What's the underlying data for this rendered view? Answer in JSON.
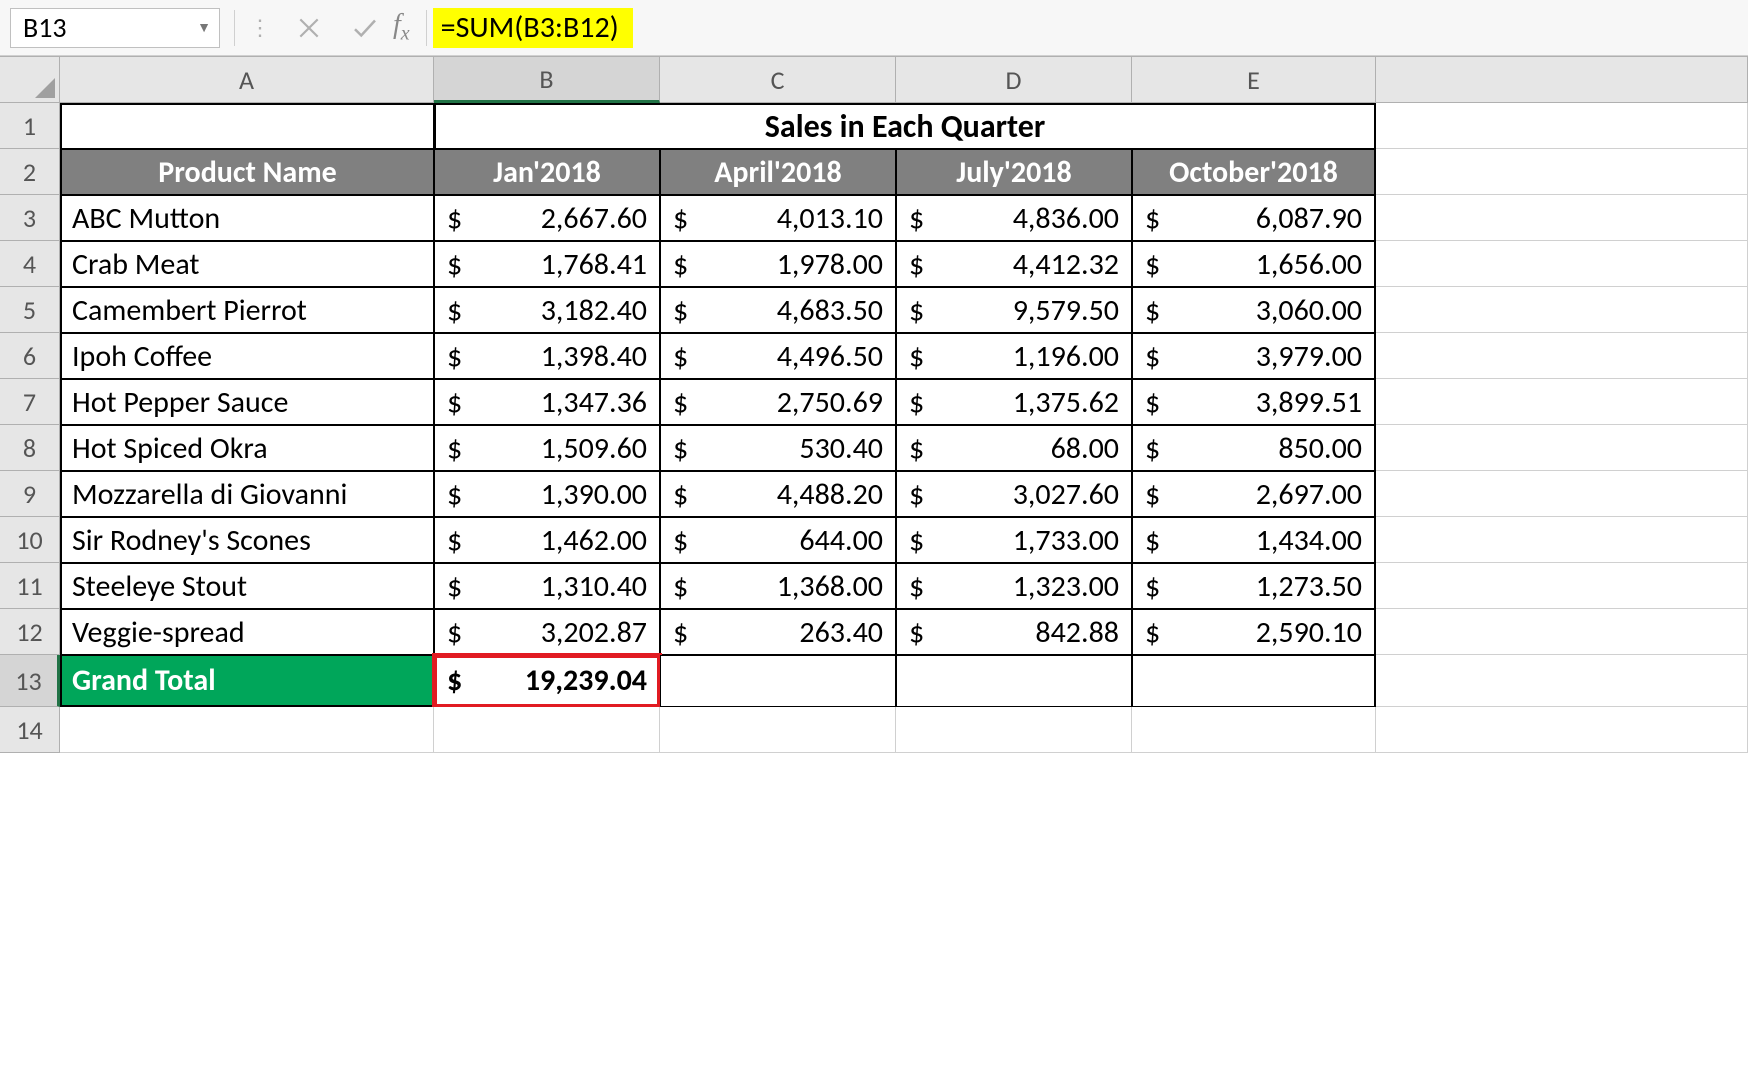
{
  "nameBox": "B13",
  "formula": "=SUM(B3:B12)",
  "columns": [
    "A",
    "B",
    "C",
    "D",
    "E"
  ],
  "mergeTitle": "Sales in Each Quarter",
  "headers": {
    "product": "Product Name",
    "q1": "Jan'2018",
    "q2": "April'2018",
    "q3": "July'2018",
    "q4": "October'2018"
  },
  "rows": [
    {
      "r": "3",
      "name": "ABC Mutton",
      "q1": "2,667.60",
      "q2": "4,013.10",
      "q3": "4,836.00",
      "q4": "6,087.90"
    },
    {
      "r": "4",
      "name": "Crab Meat",
      "q1": "1,768.41",
      "q2": "1,978.00",
      "q3": "4,412.32",
      "q4": "1,656.00"
    },
    {
      "r": "5",
      "name": "Camembert Pierrot",
      "q1": "3,182.40",
      "q2": "4,683.50",
      "q3": "9,579.50",
      "q4": "3,060.00"
    },
    {
      "r": "6",
      "name": "Ipoh Coffee",
      "q1": "1,398.40",
      "q2": "4,496.50",
      "q3": "1,196.00",
      "q4": "3,979.00"
    },
    {
      "r": "7",
      "name": "Hot Pepper Sauce",
      "q1": "1,347.36",
      "q2": "2,750.69",
      "q3": "1,375.62",
      "q4": "3,899.51"
    },
    {
      "r": "8",
      "name": " Hot Spiced Okra",
      "q1": "1,509.60",
      "q2": "530.40",
      "q3": "68.00",
      "q4": "850.00"
    },
    {
      "r": "9",
      "name": "Mozzarella di Giovanni",
      "q1": "1,390.00",
      "q2": "4,488.20",
      "q3": "3,027.60",
      "q4": "2,697.00"
    },
    {
      "r": "10",
      "name": "Sir Rodney's Scones",
      "q1": "1,462.00",
      "q2": "644.00",
      "q3": "1,733.00",
      "q4": "1,434.00"
    },
    {
      "r": "11",
      "name": "Steeleye Stout",
      "q1": "1,310.40",
      "q2": "1,368.00",
      "q3": "1,323.00",
      "q4": "1,273.50"
    },
    {
      "r": "12",
      "name": "Veggie-spread",
      "q1": "3,202.87",
      "q2": "263.40",
      "q3": "842.88",
      "q4": "2,590.10"
    }
  ],
  "grandTotal": {
    "label": "Grand Total",
    "r": "13",
    "value": "19,239.04"
  },
  "chart_data": {
    "type": "table",
    "title": "Sales in Each Quarter",
    "categories": [
      "Jan'2018",
      "April'2018",
      "July'2018",
      "October'2018"
    ],
    "series": [
      {
        "name": "ABC Mutton",
        "values": [
          2667.6,
          4013.1,
          4836.0,
          6087.9
        ]
      },
      {
        "name": "Crab Meat",
        "values": [
          1768.41,
          1978.0,
          4412.32,
          1656.0
        ]
      },
      {
        "name": "Camembert Pierrot",
        "values": [
          3182.4,
          4683.5,
          9579.5,
          3060.0
        ]
      },
      {
        "name": "Ipoh Coffee",
        "values": [
          1398.4,
          4496.5,
          1196.0,
          3979.0
        ]
      },
      {
        "name": "Hot Pepper Sauce",
        "values": [
          1347.36,
          2750.69,
          1375.62,
          3899.51
        ]
      },
      {
        "name": "Hot Spiced Okra",
        "values": [
          1509.6,
          530.4,
          68.0,
          850.0
        ]
      },
      {
        "name": "Mozzarella di Giovanni",
        "values": [
          1390.0,
          4488.2,
          3027.6,
          2697.0
        ]
      },
      {
        "name": "Sir Rodney's Scones",
        "values": [
          1462.0,
          644.0,
          1733.0,
          1434.0
        ]
      },
      {
        "name": "Steeleye Stout",
        "values": [
          1310.4,
          1368.0,
          1323.0,
          1273.5
        ]
      },
      {
        "name": "Veggie-spread",
        "values": [
          3202.87,
          263.4,
          842.88,
          2590.1
        ]
      }
    ],
    "totals": {
      "Jan'2018": 19239.04
    }
  }
}
